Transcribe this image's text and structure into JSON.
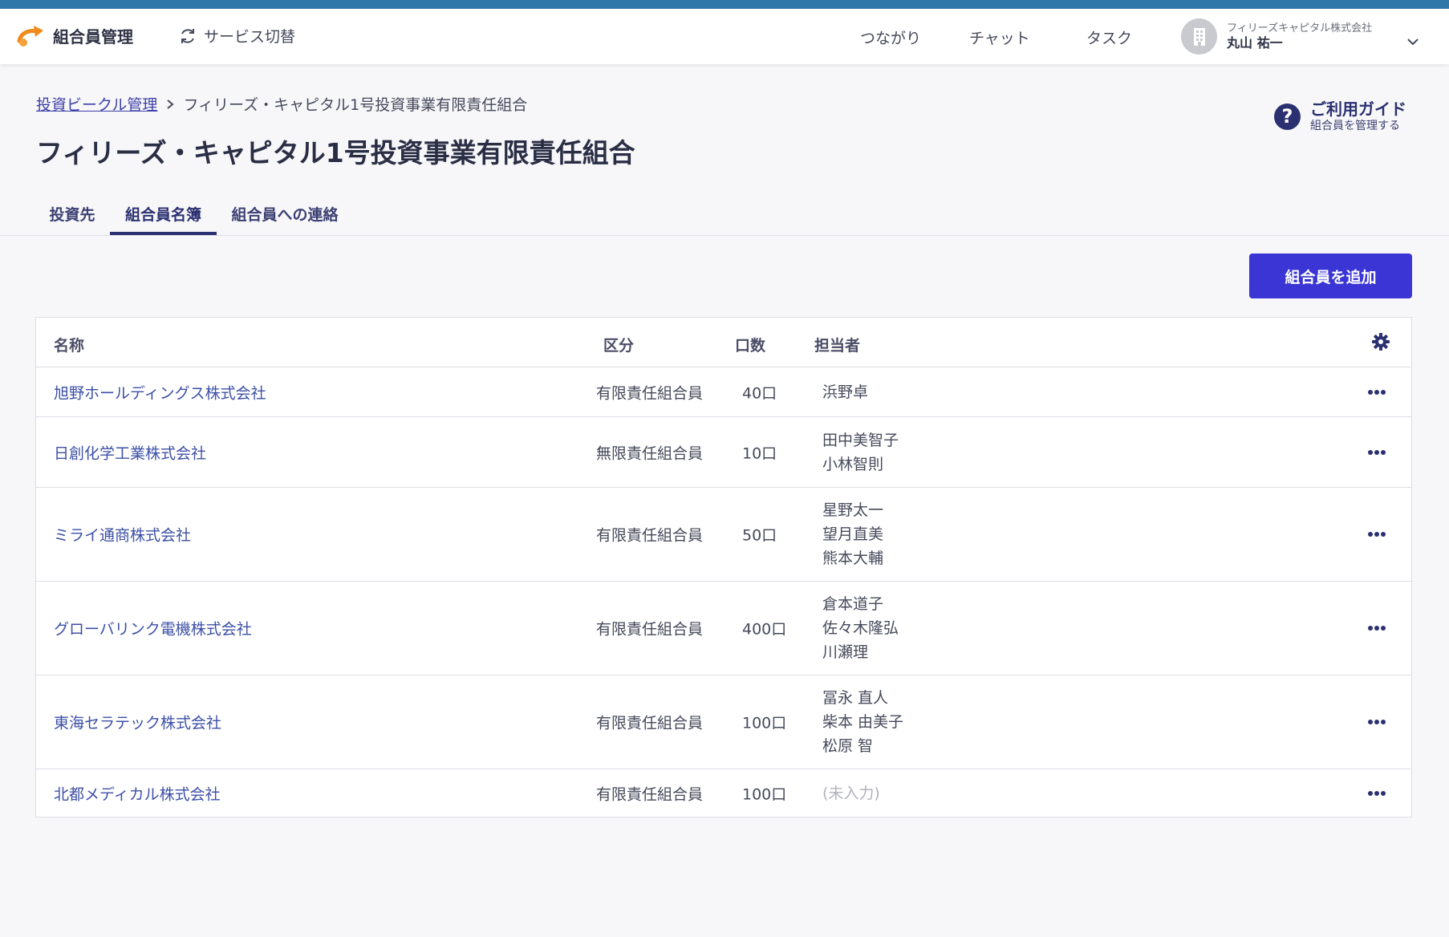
{
  "header": {
    "app_title": "組合員管理",
    "service_switch": "サービス切替",
    "nav": [
      "つながり",
      "チャット",
      "タスク"
    ],
    "user_org": "フィリーズキャピタル株式会社",
    "user_name": "丸山 祐一"
  },
  "breadcrumb": {
    "parent": "投資ビークル管理",
    "current": "フィリーズ・キャピタル1号投資事業有限責任組合"
  },
  "page_title": "フィリーズ・キャピタル1号投資事業有限責任組合",
  "guide": {
    "title": "ご利用ガイド",
    "subtitle": "組合員を管理する"
  },
  "tabs": [
    {
      "label": "投資先",
      "active": false
    },
    {
      "label": "組合員名簿",
      "active": true
    },
    {
      "label": "組合員への連絡",
      "active": false
    }
  ],
  "add_button": "組合員を追加",
  "table": {
    "columns": [
      "名称",
      "区分",
      "口数",
      "担当者"
    ],
    "rows": [
      {
        "name": "旭野ホールディングス株式会社",
        "category": "有限責任組合員",
        "units": "40口",
        "staff": [
          "浜野卓"
        ]
      },
      {
        "name": "日創化学工業株式会社",
        "category": "無限責任組合員",
        "units": "10口",
        "staff": [
          "田中美智子",
          "小林智則"
        ]
      },
      {
        "name": "ミライ通商株式会社",
        "category": "有限責任組合員",
        "units": "50口",
        "staff": [
          "星野太一",
          "望月直美",
          "熊本大輔"
        ]
      },
      {
        "name": "グローバリンク電機株式会社",
        "category": "有限責任組合員",
        "units": "400口",
        "staff": [
          "倉本道子",
          "佐々木隆弘",
          "川瀬理"
        ]
      },
      {
        "name": "東海セラテック株式会社",
        "category": "有限責任組合員",
        "units": "100口",
        "staff": [
          "冨永 直人",
          "柴本 由美子",
          "松原 智"
        ]
      },
      {
        "name": "北都メディカル株式会社",
        "category": "有限責任組合員",
        "units": "100口",
        "staff": [],
        "staff_placeholder": "(未入力)"
      }
    ]
  },
  "colors": {
    "accent": "#3a35d4",
    "navy": "#2b3070",
    "link": "#3c4fa6",
    "top_stripe": "#2f77a8",
    "logo_orange": "#f08a1c"
  }
}
